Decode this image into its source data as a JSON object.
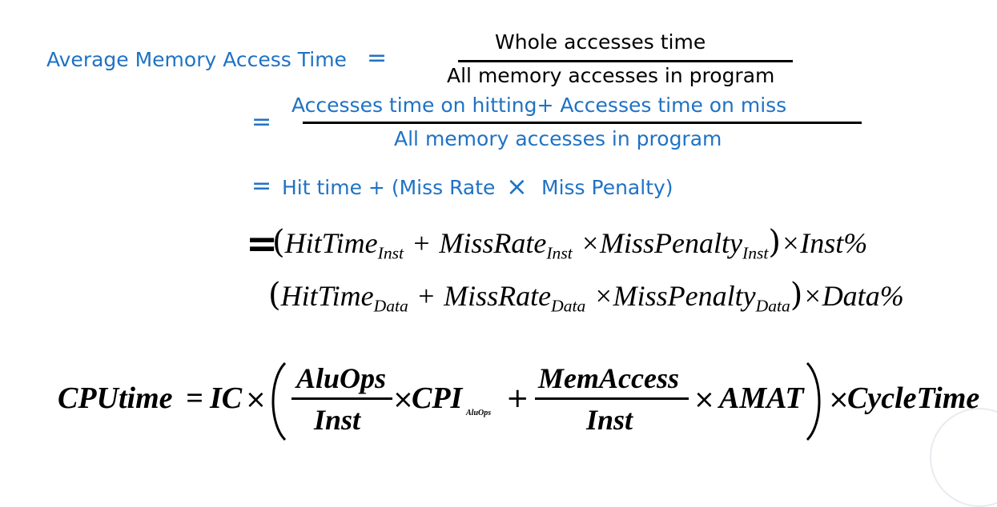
{
  "eq1": {
    "lhs": "Average Memory Access Time",
    "equals": "=",
    "numerator": "Whole accesses time",
    "denominator": "All memory accesses in program"
  },
  "eq2": {
    "equals": "=",
    "numerator": "Accesses time on hitting+ Accesses time on miss",
    "denominator": "All memory accesses in program"
  },
  "eq3": {
    "equals": "=",
    "text_a": "Hit time + (Miss Rate",
    "times": "×",
    "text_b": "Miss Penalty)"
  },
  "eq4": {
    "equals": "=",
    "line1": {
      "hit": "HitTime",
      "hit_sub": "Inst",
      "plus": "+",
      "miss": "MissRate",
      "miss_sub": "Inst",
      "times": "×",
      "penalty": "MissPenalty",
      "penalty_sub": "Inst",
      "tail": "×",
      "factor": "Inst%"
    },
    "line2": {
      "hit": "HitTime",
      "hit_sub": "Data",
      "plus": "+",
      "miss": "MissRate",
      "miss_sub": "Data",
      "times": "×",
      "penalty": "MissPenalty",
      "penalty_sub": "Data",
      "tail": "×",
      "factor": "Data%"
    }
  },
  "cpu": {
    "lhs": "CPUtime",
    "equals": "=",
    "ic": "IC",
    "times": "×",
    "frac1_num": "AluOps",
    "frac1_den": "Inst",
    "cpi": "CPI",
    "cpi_sub": "AluOps",
    "plus": "+",
    "frac2_num": "MemAccess",
    "frac2_den": "Inst",
    "amat": "AMAT",
    "cycle": "CycleTime"
  },
  "colors": {
    "blue_text": "#1f72c4",
    "black_text": "#000000"
  }
}
